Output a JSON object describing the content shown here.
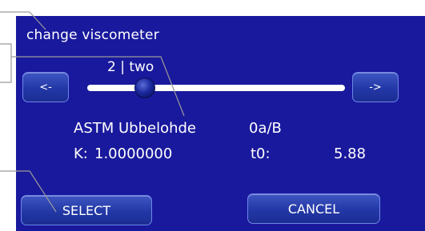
{
  "screen": {
    "title": "change viscometer",
    "slider_value": "2 | two",
    "prev_label": "<-",
    "next_label": "->",
    "viscometer_type": "ASTM Ubbelohde",
    "viscometer_size": "0a/B",
    "k_label": "K:",
    "k_value": "1.0000000",
    "t0_label": "t0:",
    "t0_value": "5.88",
    "select_label": "SELECT",
    "cancel_label": "CANCEL"
  },
  "colors": {
    "screen_background": "#19199d",
    "button": "#2338a6",
    "text": "#ffffff"
  }
}
